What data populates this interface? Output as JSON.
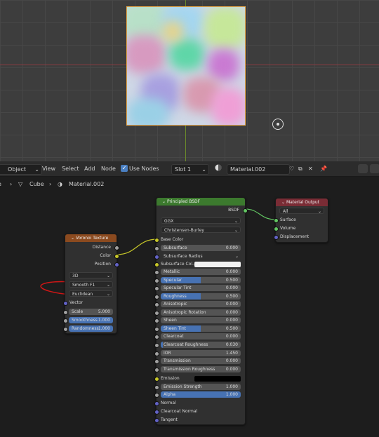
{
  "header": {
    "mode": "Object",
    "menus": [
      "View",
      "Select",
      "Add",
      "Node"
    ],
    "use_nodes": "Use Nodes",
    "slot": "Slot 1",
    "material": "Material.002"
  },
  "breadcrumb": {
    "object": "Cube",
    "material": "Material.002"
  },
  "voronoi": {
    "title": "Voronoi Texture",
    "outputs": [
      "Distance",
      "Color",
      "Position"
    ],
    "dim": "3D",
    "feature": "Smooth F1",
    "metric": "Euclidean",
    "vector_label": "Vector",
    "inputs": [
      {
        "label": "Scale",
        "value": "5.000"
      },
      {
        "label": "Smoothness",
        "value": "1.000"
      },
      {
        "label": "Randomness",
        "value": "1.000"
      }
    ]
  },
  "bsdf": {
    "title": "Principled BSDF",
    "output": "BSDF",
    "distribution": "GGX",
    "subsurface_method": "Christensen-Burley",
    "base_color": "Base Color",
    "subsurface": {
      "label": "Subsurface",
      "value": "0.000"
    },
    "subsurface_radius": "Subsurface Radius",
    "subsurface_color": "Subsurface Col...",
    "sliders": [
      {
        "label": "Metallic",
        "value": "0.000",
        "fill": 0
      },
      {
        "label": "Specular",
        "value": "0.500",
        "fill": 0.5
      },
      {
        "label": "Specular Tint",
        "value": "0.000",
        "fill": 0
      },
      {
        "label": "Roughness",
        "value": "0.500",
        "fill": 0.5
      },
      {
        "label": "Anisotropic",
        "value": "0.000",
        "fill": 0
      },
      {
        "label": "Anisotropic Rotation",
        "value": "0.000",
        "fill": 0
      },
      {
        "label": "Sheen",
        "value": "0.000",
        "fill": 0
      },
      {
        "label": "Sheen Tint",
        "value": "0.500",
        "fill": 0.5
      },
      {
        "label": "Clearcoat",
        "value": "0.000",
        "fill": 0
      },
      {
        "label": "Clearcoat Roughness",
        "value": "0.030",
        "fill": 0.03
      },
      {
        "label": "IOR",
        "value": "1.450",
        "fill": 0
      },
      {
        "label": "Transmission",
        "value": "0.000",
        "fill": 0
      },
      {
        "label": "Transmission Roughness",
        "value": "0.000",
        "fill": 0
      }
    ],
    "emission": "Emission",
    "emission_strength": {
      "label": "Emission Strength",
      "value": "1.000"
    },
    "alpha": {
      "label": "Alpha",
      "value": "1.000"
    },
    "normal": "Normal",
    "clearcoat_normal": "Clearcoat Normal",
    "tangent": "Tangent"
  },
  "output_node": {
    "title": "Material Output",
    "target": "All",
    "inputs": [
      "Surface",
      "Volume",
      "Displacement"
    ]
  },
  "colors": {
    "voronoi_header": "#8b4a1f",
    "bsdf_header": "#3c7a2e",
    "output_header": "#7a2c35",
    "annotation": "#d01616"
  }
}
